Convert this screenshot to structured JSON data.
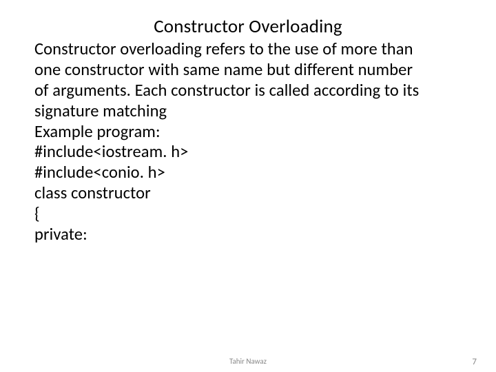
{
  "slide": {
    "title": "Constructor Overloading",
    "body": {
      "line1": "Constructor overloading refers to the use of more than",
      "line2": "one constructor with same name but different number",
      "line3": "of arguments. Each constructor is called according to its",
      "line4": "signature matching",
      "line5": "Example program:",
      "line6": "#include<iostream. h>",
      "line7": "#include<conio. h>",
      "line8": "class constructor",
      "line9": "{",
      "line10": "private:"
    },
    "footer": {
      "author": "Tahir Nawaz",
      "page": "7"
    }
  }
}
